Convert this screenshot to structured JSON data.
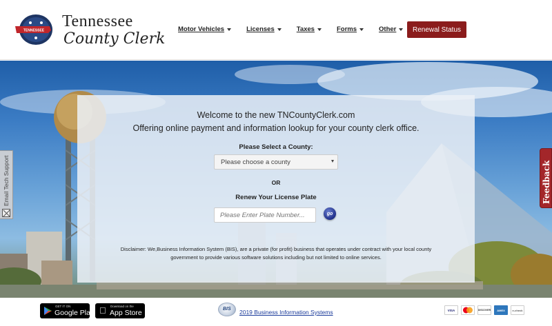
{
  "header": {
    "logo_seal_text": "TENNESSEE",
    "logo_line1": "Tennessee",
    "logo_line2": "County Clerk",
    "nav": [
      {
        "label": "Motor Vehicles"
      },
      {
        "label": "Licenses"
      },
      {
        "label": "Taxes"
      },
      {
        "label": "Forms"
      },
      {
        "label": "Other"
      }
    ],
    "renewal_button": "Renewal Status"
  },
  "panel": {
    "welcome_line1": "Welcome to the new TNCountyClerk.com",
    "welcome_line2": "Offering online payment and information lookup for your county clerk office.",
    "select_county_label": "Please Select a County:",
    "county_select_value": "Please choose a county",
    "or_text": "OR",
    "renew_plate_label": "Renew Your License Plate",
    "plate_placeholder": "Please Enter Plate Number...",
    "go_button": "go",
    "disclaimer": "Disclaimer: We,Business Information System (BIS), are a private (for profit) business that operates under contract with your local county government to provide various software solutions including but not limited to online services."
  },
  "side_tabs": {
    "tech_support": "Email Tech Support",
    "feedback": "Feedback"
  },
  "footer": {
    "google_play_small": "GET IT ON",
    "google_play_big": "Google Play",
    "app_store_small": "Download on the",
    "app_store_big": "App Store",
    "bis_logo_text": "BIS",
    "copyright": "2019 Business Information Systems",
    "cards": [
      "VISA",
      "",
      "DISCOVER",
      "AMEX",
      "e-check"
    ]
  },
  "colors": {
    "renewal_button_bg": "#8b1c1c",
    "feedback_tab_bg": "#a3262a",
    "link_blue": "#1a3a9a"
  }
}
